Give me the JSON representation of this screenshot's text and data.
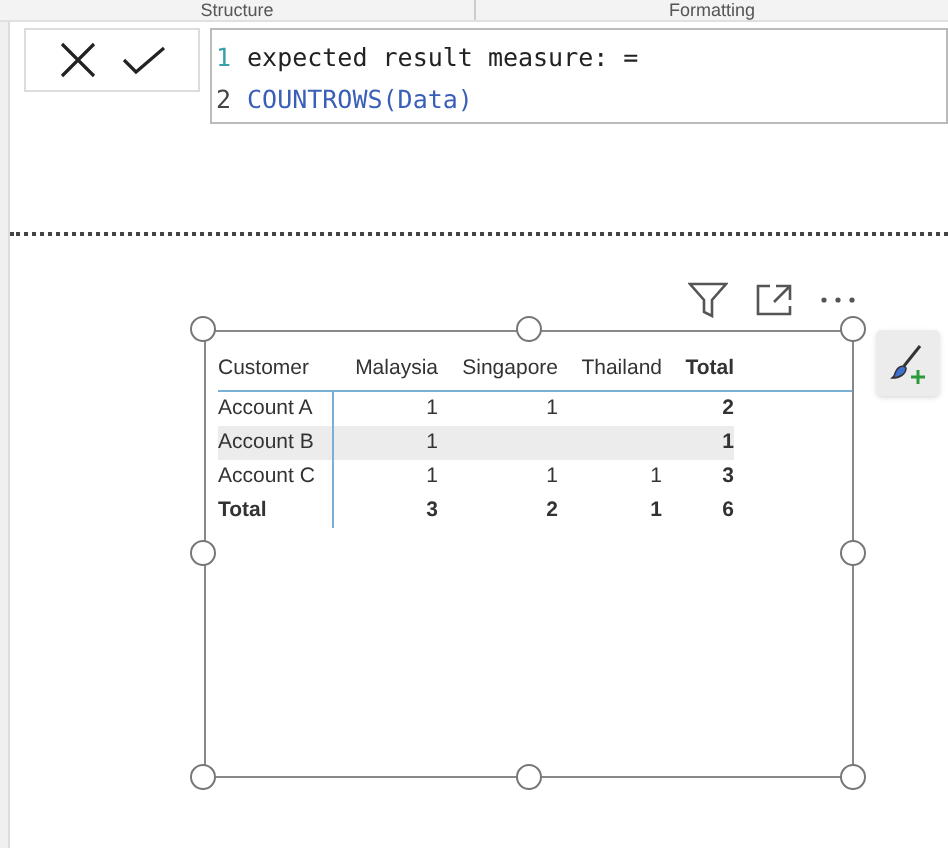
{
  "ribbon": {
    "groups": [
      "Structure",
      "Formatting"
    ]
  },
  "formula_bar": {
    "lines": [
      {
        "number": "1",
        "text": "expected result measure: =",
        "kind": "plain"
      },
      {
        "number": "2",
        "text": "COUNTROWS(Data)",
        "kind": "function"
      }
    ]
  },
  "visual": {
    "table": {
      "columns": [
        "Customer",
        "Malaysia",
        "Singapore",
        "Thailand",
        "Total"
      ],
      "rows": [
        {
          "cells": [
            "Account A",
            "1",
            "1",
            "",
            "2"
          ],
          "highlighted": false,
          "kind": "data"
        },
        {
          "cells": [
            "Account B",
            "1",
            "",
            "",
            "1"
          ],
          "highlighted": true,
          "kind": "data"
        },
        {
          "cells": [
            "Account C",
            "1",
            "1",
            "1",
            "3"
          ],
          "highlighted": false,
          "kind": "data"
        },
        {
          "cells": [
            "Total",
            "3",
            "2",
            "1",
            "6"
          ],
          "highlighted": false,
          "kind": "total"
        }
      ]
    }
  }
}
